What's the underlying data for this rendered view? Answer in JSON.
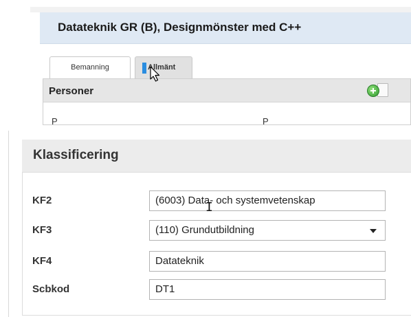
{
  "course": {
    "title": "Datateknik GR (B), Designmönster med C++"
  },
  "tabs": [
    {
      "label": "Bemanning",
      "active": true
    },
    {
      "label": "Allmänt",
      "active": false
    }
  ],
  "personer": {
    "title": "Personer",
    "add_icon": "add-icon",
    "columns": [
      "P",
      "P"
    ]
  },
  "klassificering": {
    "title": "Klassificering",
    "fields": [
      {
        "label": "KF2",
        "value": "(6003) Data- och systemvetenskap",
        "type": "text"
      },
      {
        "label": "KF3",
        "value": "(110) Grundutbildning",
        "type": "select"
      },
      {
        "label": "KF4",
        "value": "Datateknik",
        "type": "text"
      },
      {
        "label": "Scbkod",
        "value": "DT1",
        "type": "text"
      }
    ]
  },
  "colors": {
    "header_blue": "#dfe9f4",
    "tab_marker": "#2a8de0",
    "add_green": "#2f9a2f"
  }
}
